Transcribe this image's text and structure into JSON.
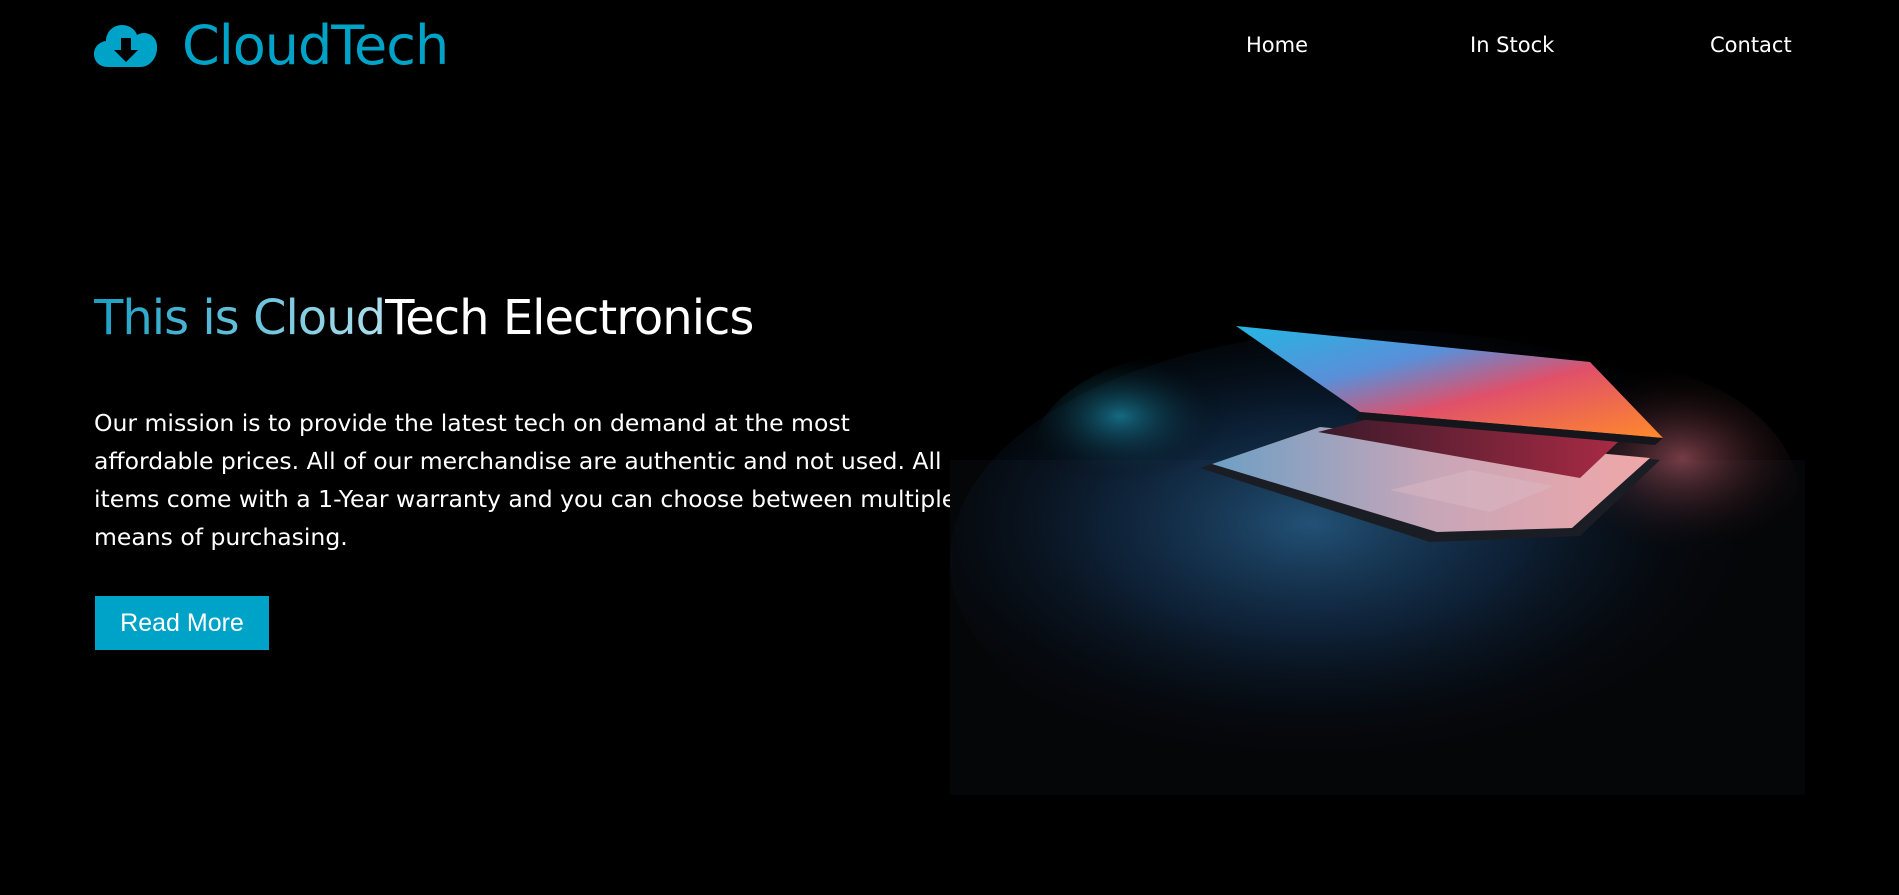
{
  "colors": {
    "background": "#000000",
    "accent": "#00a3c8",
    "title_gradient_start": "#1a9fc4",
    "title_gradient_end": "#b8e4f0",
    "text": "#ffffff"
  },
  "header": {
    "brand": {
      "icon": "cloud-download-icon",
      "name": "CloudTech"
    },
    "nav": [
      {
        "label": "Home"
      },
      {
        "label": "In Stock"
      },
      {
        "label": "Contact"
      }
    ]
  },
  "hero": {
    "title_parts": [
      "This is ",
      "Cloud",
      "Tech Electronics"
    ],
    "description": "Our mission is to provide the latest tech on demand at the most affordable prices. All of our merchandise are authentic and not used. All items come with a 1-Year warranty and you can choose between multiple means of purchasing.",
    "button_label": "Read More",
    "image": "laptop-photo"
  }
}
